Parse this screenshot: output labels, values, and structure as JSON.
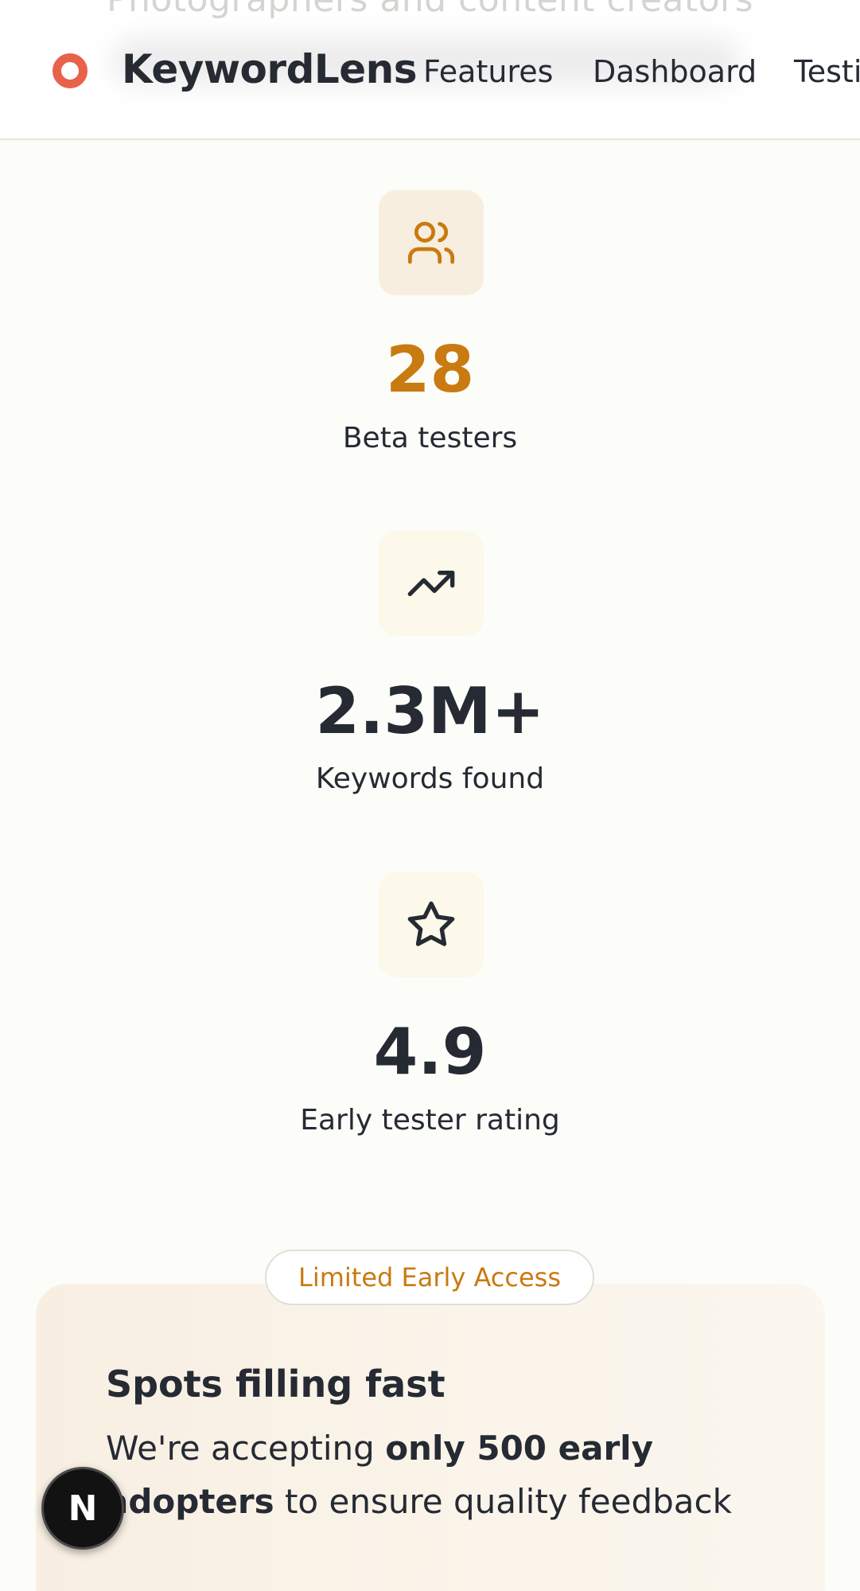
{
  "header": {
    "ghost_text": "Photographers and content creators",
    "brand": "KeywordLens",
    "nav": [
      "Features",
      "Dashboard",
      "Testi"
    ]
  },
  "stats": [
    {
      "icon": "users-icon",
      "value": "28",
      "label": "Beta testers",
      "value_color": "#c97a10"
    },
    {
      "icon": "trending-up-icon",
      "value": "2.3M+",
      "label": "Keywords found",
      "value_color": "#252a33"
    },
    {
      "icon": "star-icon",
      "value": "4.9",
      "label": "Early tester rating",
      "value_color": "#252a33"
    }
  ],
  "early_access": {
    "badge": "Limited Early Access",
    "title": "Spots filling fast",
    "line1_pre": "We're accepting ",
    "line1_bold": "only 500 early",
    "line2_bold": "adopters",
    "line2_post": " to ensure quality feedback"
  },
  "floating_button": {
    "label": "N"
  },
  "colors": {
    "accent": "#c97a10",
    "logo": "#e8614b",
    "text": "#252a33",
    "background": "#fcfcf8"
  }
}
